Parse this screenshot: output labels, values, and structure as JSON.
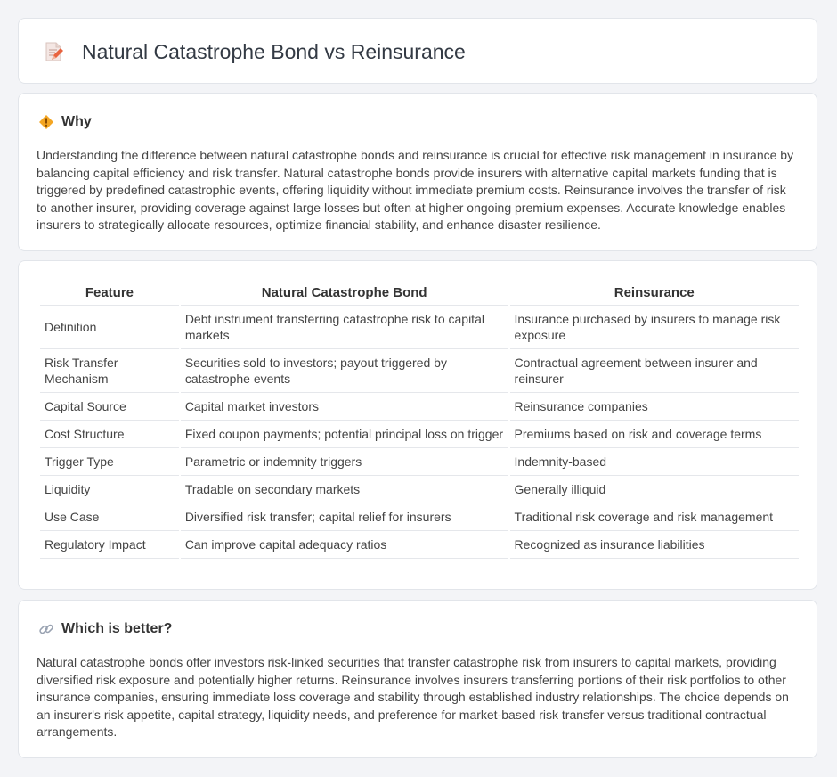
{
  "header": {
    "title": "Natural Catastrophe Bond vs Reinsurance",
    "icon": "document-pencil-icon"
  },
  "why": {
    "title": "Why",
    "icon": "diamond-warning-icon",
    "text": "Understanding the difference between natural catastrophe bonds and reinsurance is crucial for effective risk management in insurance by balancing capital efficiency and risk transfer. Natural catastrophe bonds provide insurers with alternative capital markets funding that is triggered by predefined catastrophic events, offering liquidity without immediate premium costs. Reinsurance involves the transfer of risk to another insurer, providing coverage against large losses but often at higher ongoing premium expenses. Accurate knowledge enables insurers to strategically allocate resources, optimize financial stability, and enhance disaster resilience."
  },
  "table": {
    "headers": [
      "Feature",
      "Natural Catastrophe Bond",
      "Reinsurance"
    ],
    "rows": [
      [
        "Definition",
        "Debt instrument transferring catastrophe risk to capital markets",
        "Insurance purchased by insurers to manage risk exposure"
      ],
      [
        "Risk Transfer Mechanism",
        "Securities sold to investors; payout triggered by catastrophe events",
        "Contractual agreement between insurer and reinsurer"
      ],
      [
        "Capital Source",
        "Capital market investors",
        "Reinsurance companies"
      ],
      [
        "Cost Structure",
        "Fixed coupon payments; potential principal loss on trigger",
        "Premiums based on risk and coverage terms"
      ],
      [
        "Trigger Type",
        "Parametric or indemnity triggers",
        "Indemnity-based"
      ],
      [
        "Liquidity",
        "Tradable on secondary markets",
        "Generally illiquid"
      ],
      [
        "Use Case",
        "Diversified risk transfer; capital relief for insurers",
        "Traditional risk coverage and risk management"
      ],
      [
        "Regulatory Impact",
        "Can improve capital adequacy ratios",
        "Recognized as insurance liabilities"
      ]
    ]
  },
  "better": {
    "title": "Which is better?",
    "icon": "link-icon",
    "text": "Natural catastrophe bonds offer investors risk-linked securities that transfer catastrophe risk from insurers to capital markets, providing diversified risk exposure and potentially higher returns. Reinsurance involves insurers transferring portions of their risk portfolios to other insurance companies, ensuring immediate loss coverage and stability through established industry relationships. The choice depends on an insurer's risk appetite, capital strategy, liquidity needs, and preference for market-based risk transfer versus traditional contractual arrangements."
  }
}
